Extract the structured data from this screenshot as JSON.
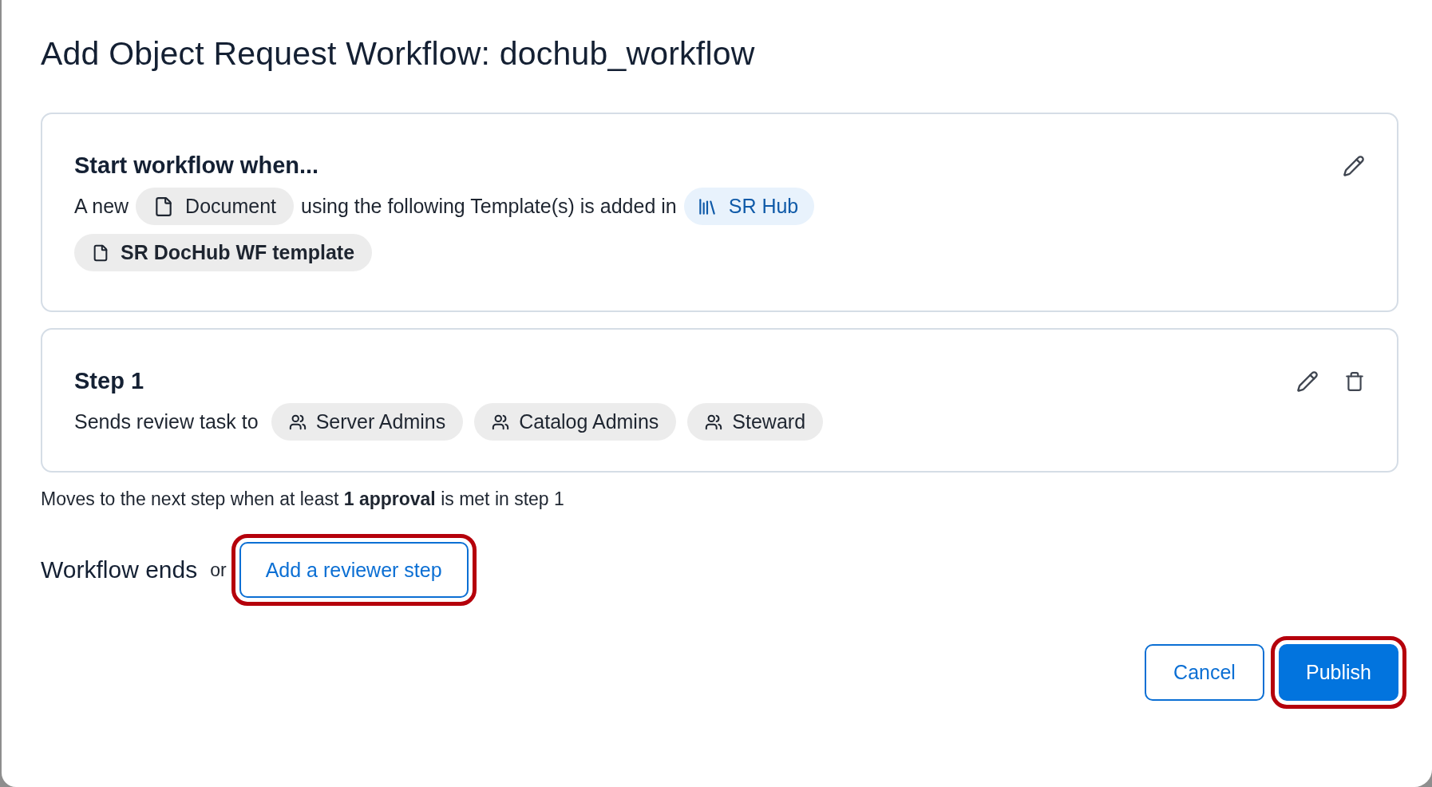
{
  "dialog": {
    "title": "Add Object Request Workflow: dochub_workflow"
  },
  "trigger": {
    "heading": "Start workflow when...",
    "parts": [
      {
        "kind": "text",
        "text": "A new"
      },
      {
        "kind": "object",
        "text": "Document"
      },
      {
        "kind": "text",
        "text": "using the following Template(s) is added in"
      },
      {
        "kind": "hub",
        "text": "SR Hub"
      }
    ],
    "templates": [
      {
        "label": "SR DocHub WF template"
      }
    ]
  },
  "steps": [
    {
      "title": "Step 1",
      "lead": "Sends review task to",
      "reviewers": [
        {
          "label": "Server Admins"
        },
        {
          "label": "Catalog Admins"
        },
        {
          "label": "Steward"
        }
      ]
    }
  ],
  "rule": "Moves to the next step when at least **1 approval** is met in step 1",
  "ending": {
    "label": "Workflow ends",
    "conjunction": "or",
    "action": {
      "label": "Add a reviewer step",
      "highlighted": true
    }
  },
  "buttons": [
    {
      "label": "Cancel",
      "kind": "secondary",
      "highlighted": false
    },
    {
      "label": "Publish",
      "kind": "primary",
      "highlighted": true
    }
  ]
}
